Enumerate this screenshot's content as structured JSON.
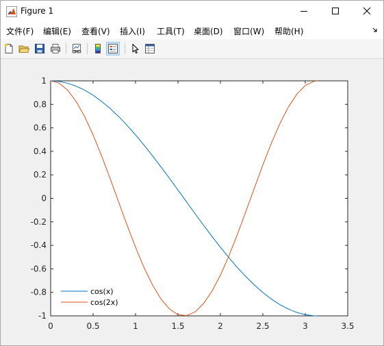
{
  "window": {
    "title": "Figure 1"
  },
  "menu": {
    "items": [
      "文件(F)",
      "编辑(E)",
      "查看(V)",
      "插入(I)",
      "工具(T)",
      "桌面(D)",
      "窗口(W)",
      "帮助(H)"
    ]
  },
  "toolbar": {
    "icons": [
      "new-figure-icon",
      "open-file-icon",
      "save-icon",
      "print-icon",
      "link-plot-icon",
      "colorbar-icon",
      "legend-icon",
      "edit-plot-icon",
      "property-inspector-icon"
    ]
  },
  "colors": {
    "series1": "#0072BD",
    "series2": "#D95319",
    "axes_bg": "#ffffff",
    "figure_bg": "#f0f0f0"
  },
  "chart_data": {
    "type": "line",
    "title": "",
    "xlabel": "",
    "ylabel": "",
    "xlim": [
      0,
      3.5
    ],
    "ylim": [
      -1,
      1
    ],
    "xticks": [
      "0",
      "0.5",
      "1",
      "1.5",
      "2",
      "2.5",
      "3",
      "3.5"
    ],
    "yticks": [
      "-1",
      "-0.8",
      "-0.6",
      "-0.4",
      "-0.2",
      "0",
      "0.2",
      "0.4",
      "0.6",
      "0.8",
      "1"
    ],
    "grid": false,
    "legend_position": "bottom-left",
    "x": [
      0,
      0.1,
      0.2,
      0.3,
      0.4,
      0.5,
      0.6,
      0.7,
      0.8,
      0.9,
      1.0,
      1.1,
      1.2,
      1.3,
      1.4,
      1.5,
      1.6,
      1.7,
      1.8,
      1.9,
      2.0,
      2.1,
      2.2,
      2.3,
      2.4,
      2.5,
      2.6,
      2.7,
      2.8,
      2.9,
      3.0,
      3.1,
      3.1416
    ],
    "series": [
      {
        "name": "cos(x)",
        "values": [
          1,
          0.995,
          0.98,
          0.955,
          0.921,
          0.878,
          0.825,
          0.765,
          0.697,
          0.622,
          0.54,
          0.454,
          0.362,
          0.267,
          0.17,
          0.071,
          -0.029,
          -0.129,
          -0.227,
          -0.323,
          -0.416,
          -0.505,
          -0.589,
          -0.666,
          -0.737,
          -0.801,
          -0.857,
          -0.904,
          -0.942,
          -0.971,
          -0.99,
          -0.999,
          -1
        ]
      },
      {
        "name": "cos(2x)",
        "values": [
          1,
          0.98,
          0.921,
          0.825,
          0.697,
          0.54,
          0.362,
          0.17,
          -0.029,
          -0.227,
          -0.416,
          -0.589,
          -0.737,
          -0.857,
          -0.942,
          -0.99,
          -0.998,
          -0.967,
          -0.897,
          -0.791,
          -0.654,
          -0.49,
          -0.307,
          -0.112,
          0.087,
          0.284,
          0.469,
          0.635,
          0.776,
          0.886,
          0.96,
          0.996,
          1
        ]
      }
    ]
  }
}
